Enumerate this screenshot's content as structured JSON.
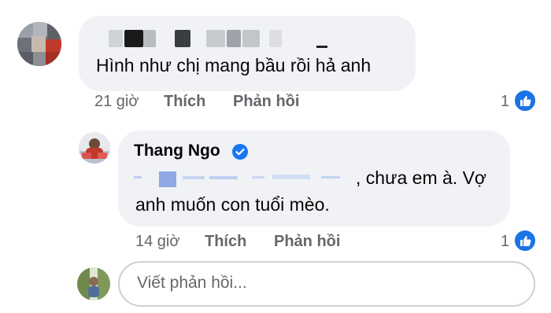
{
  "comment1": {
    "author_redacted": true,
    "text": "Hình như chị mang bầu rồi hả anh",
    "time": "21 giờ",
    "like_label": "Thích",
    "reply_label": "Phản hồi",
    "reaction_count": "1",
    "reaction_icon": "like-icon"
  },
  "reply1": {
    "author": "Thang Ngo",
    "verified_icon": "verified-badge-icon",
    "mention_redacted": true,
    "text_after_mention": ", chưa em à. Vợ",
    "text_line2": "anh muốn con tuổi mèo.",
    "time": "14 giờ",
    "like_label": "Thích",
    "reply_label": "Phản hồi",
    "reaction_count": "1",
    "reaction_icon": "like-icon"
  },
  "composer": {
    "placeholder": "Viết phản hồi..."
  },
  "colors": {
    "bubble_bg": "#f0f2f5",
    "meta_text": "#65676b",
    "like_blue": "#1b74e4",
    "verified_blue": "#1877f2"
  }
}
